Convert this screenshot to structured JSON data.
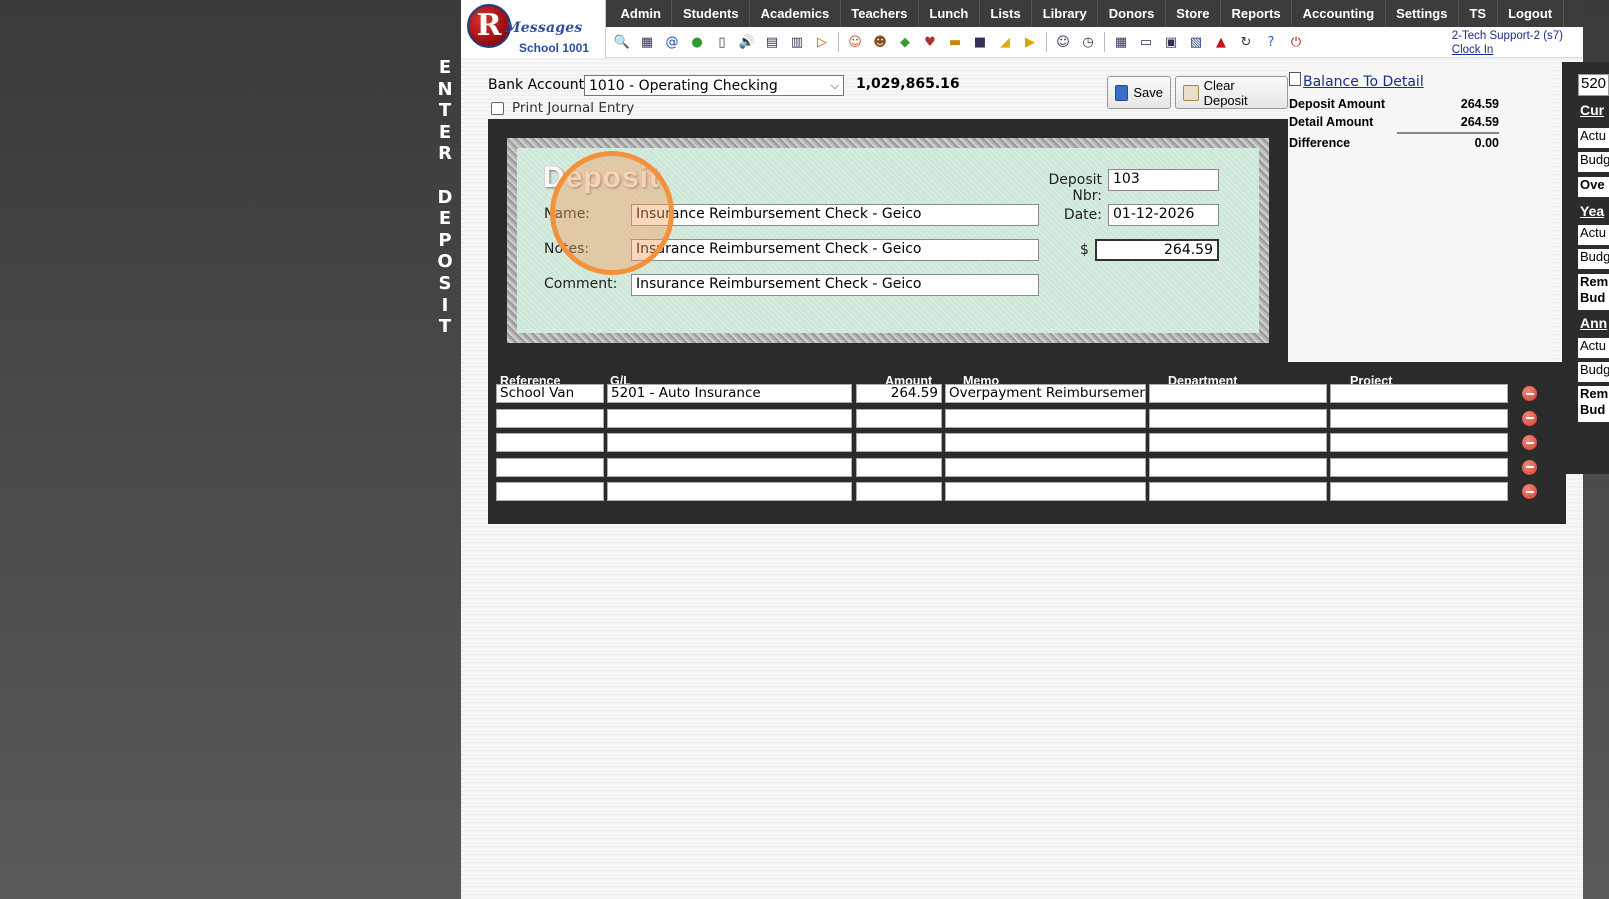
{
  "side_title": [
    "E",
    "N",
    "T",
    "E",
    "R",
    "",
    "D",
    "E",
    "P",
    "O",
    "S",
    "I",
    "T"
  ],
  "logo": {
    "title": "Messages",
    "subtitle": "School 1001",
    "letter": "R"
  },
  "nav": [
    "Admin",
    "Students",
    "Academics",
    "Teachers",
    "Lunch",
    "Lists",
    "Library",
    "Donors",
    "Store",
    "Reports",
    "Accounting",
    "Settings",
    "TS",
    "Logout"
  ],
  "toolbar_icons": [
    "search-icon",
    "calendar-grid-icon",
    "email-icon",
    "chat-icon",
    "mobile-icon",
    "speaker-icon",
    "calendar-icon",
    "calendar-day-icon",
    "megaphone-icon",
    "sep",
    "teacher-icon",
    "student-icon",
    "money-icon",
    "family-icon",
    "lunch-icon",
    "book-icon",
    "cheese-icon",
    "folder-icon",
    "sep",
    "person-icon",
    "clock-icon",
    "sep",
    "spreadsheet-icon",
    "card-icon",
    "printer-icon",
    "ap-icon",
    "pdf-icon",
    "sync-icon",
    "help-icon",
    "power-icon"
  ],
  "user": {
    "name": "2-Tech Support-2 (s7)",
    "clock": "Clock In"
  },
  "bank": {
    "label": "Bank Account",
    "selected": "1010 - Operating Checking",
    "balance": "1,029,865.16"
  },
  "print_journal": "Print Journal Entry",
  "buttons": {
    "save": "Save",
    "clear": "Clear Deposit"
  },
  "balance": {
    "link": "Balance To Detail",
    "deposit_label": "Deposit Amount",
    "deposit_value": "264.59",
    "detail_label": "Detail Amount",
    "detail_value": "264.59",
    "diff_label": "Difference",
    "diff_value": "0.00"
  },
  "check": {
    "watermark": "Deposit",
    "name_label": "Name:",
    "name": "Insurance Reimbursement Check - Geico",
    "notes_label": "Notes:",
    "notes": "Insurance Reimbursement Check - Geico",
    "comment_label": "Comment:",
    "comment": "Insurance Reimbursement Check - Geico",
    "nbr_label": "Deposit Nbr:",
    "nbr": "103",
    "date_label": "Date:",
    "date": "01-12-2026",
    "dollar": "$",
    "amount": "264.59"
  },
  "detail": {
    "headers": [
      "Reference",
      "G/L",
      "Amount",
      "Memo",
      "Department",
      "Project"
    ],
    "rows": [
      [
        "School Van",
        "5201 - Auto Insurance",
        "264.59",
        "Overpayment Reimbursement",
        "",
        ""
      ],
      [
        "",
        "",
        "",
        "",
        "",
        ""
      ],
      [
        "",
        "",
        "",
        "",
        "",
        ""
      ],
      [
        "",
        "",
        "",
        "",
        "",
        ""
      ],
      [
        "",
        "",
        "",
        "",
        "",
        ""
      ]
    ]
  },
  "cut_panel": [
    {
      "t": "520",
      "k": "val"
    },
    {
      "t": "Cur",
      "k": "h"
    },
    {
      "t": "Actu",
      "k": "n"
    },
    {
      "t": "Budg",
      "k": "n"
    },
    {
      "t": "Ove",
      "k": "b"
    },
    {
      "t": "Yea",
      "k": "h"
    },
    {
      "t": "Actu",
      "k": "n"
    },
    {
      "t": "Budg",
      "k": "n"
    },
    {
      "t": "Rem",
      "k": "b"
    },
    {
      "t": "Bud",
      "k": "b"
    },
    {
      "t": "Ann",
      "k": "h"
    },
    {
      "t": "Actu",
      "k": "n"
    },
    {
      "t": "Budg",
      "k": "n"
    },
    {
      "t": "Rem",
      "k": "b"
    },
    {
      "t": "Bud",
      "k": "b"
    }
  ]
}
